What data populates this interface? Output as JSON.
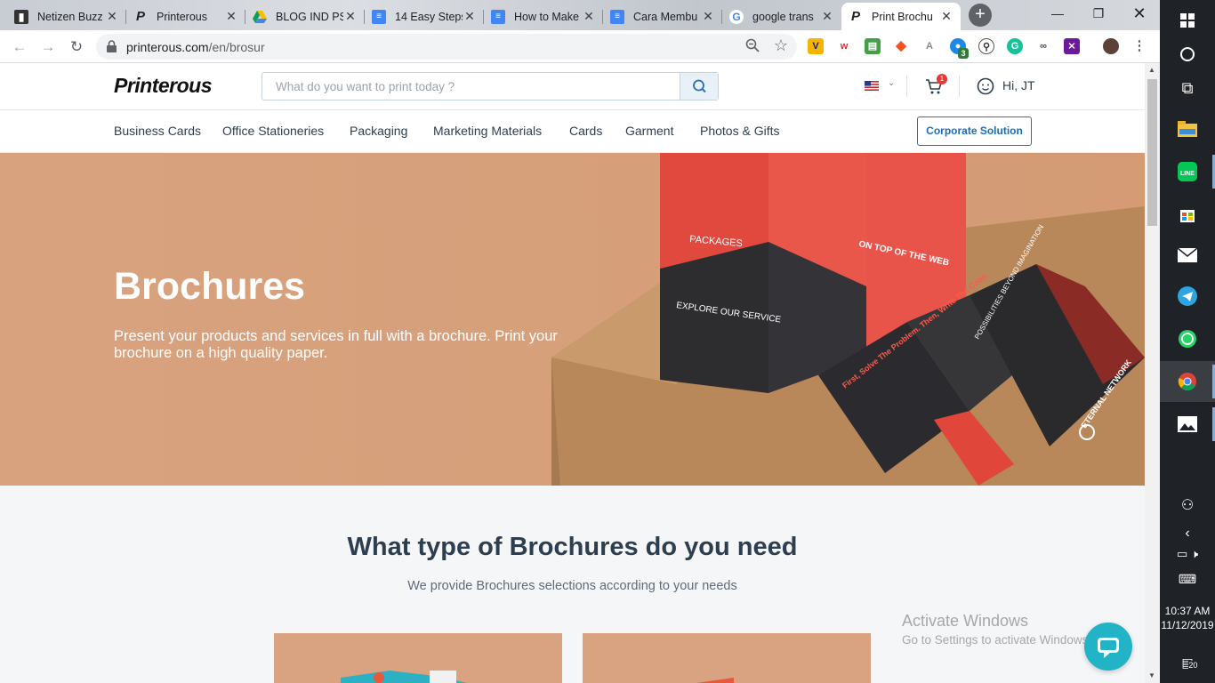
{
  "browser": {
    "tabs": [
      {
        "title": "Netizen Buzz",
        "favicon": "netizen-icon",
        "active": false
      },
      {
        "title": "Printerous",
        "favicon": "printerous-icon",
        "active": false
      },
      {
        "title": "BLOG IND PS",
        "favicon": "google-drive-icon",
        "active": false
      },
      {
        "title": "14 Easy Steps",
        "favicon": "google-docs-icon",
        "active": false
      },
      {
        "title": "How to Make",
        "favicon": "google-docs-icon",
        "active": false
      },
      {
        "title": "Cara Membu",
        "favicon": "google-docs-icon",
        "active": false
      },
      {
        "title": "google trans",
        "favicon": "google-icon",
        "active": false
      },
      {
        "title": "Print Brochu",
        "favicon": "printerous-icon",
        "active": true
      }
    ],
    "url_host": "printerous.com",
    "url_path": "/en/brosur",
    "extension_badge": "3"
  },
  "site": {
    "logo": "Printerous",
    "search_placeholder": "What do you want to print today ?",
    "cart_count": "1",
    "greeting": "Hi, JT",
    "categories": [
      "Business Cards",
      "Office Stationeries",
      "Packaging",
      "Marketing Materials",
      "Cards",
      "Garment",
      "Photos & Gifts"
    ],
    "corporate_button": "Corporate Solution"
  },
  "hero": {
    "title": "Brochures",
    "description": "Present your products and services in full with a brochure. Print your brochure on a high quality paper.",
    "art_text": {
      "packages": "PACKAGES",
      "explore": "EXPLORE OUR SERVICE",
      "top_web": "ON TOP OF THE WEB",
      "first_solve": "First, Solve The Problem. Then, Write The Code.",
      "possibilities": "POSSIBILITIES BEYOND IMAGINATION",
      "eternal": "ETERNAL NETWORK"
    }
  },
  "section": {
    "title": "What type of Brochures do you need",
    "subtitle": "We provide Brochures selections according to your needs"
  },
  "watermark": {
    "line1": "Activate Windows",
    "line2": "Go to Settings to activate Windows."
  },
  "taskbar": {
    "time": "10:37 AM",
    "date": "11/12/2019",
    "notifications": "20"
  }
}
